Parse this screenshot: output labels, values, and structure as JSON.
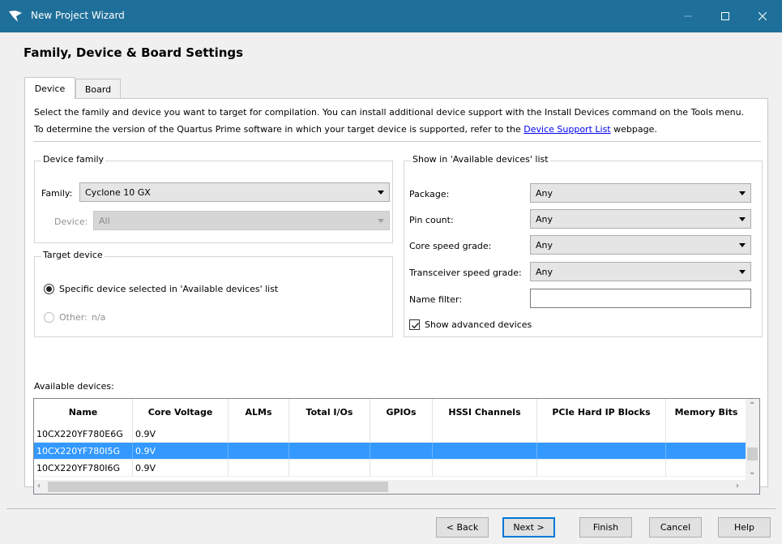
{
  "window": {
    "title": "New Project Wizard"
  },
  "page": {
    "title": "Family, Device & Board Settings"
  },
  "tabs": [
    {
      "label": "Device"
    },
    {
      "label": "Board"
    }
  ],
  "description": {
    "line1": "Select the family and device you want to target for compilation. You can install additional device support with the Install Devices command on the Tools menu.",
    "line2_prefix": "To determine the version of the Quartus Prime software in which your target device is supported, refer to the ",
    "link": "Device Support List",
    "line2_suffix": " webpage."
  },
  "device_family": {
    "legend": "Device family",
    "family_label": "Family:",
    "family_value": "Cyclone 10 GX",
    "device_label": "Device:",
    "device_value": "All"
  },
  "target_device": {
    "legend": "Target device",
    "specific_label": "Specific device selected in 'Available devices' list",
    "other_label": "Other:",
    "other_value": "n/a"
  },
  "show_list": {
    "legend": "Show in 'Available devices' list",
    "package_label": "Package:",
    "package_value": "Any",
    "pin_label": "Pin count:",
    "pin_value": "Any",
    "speed_label": "Core speed grade:",
    "speed_value": "Any",
    "xcvr_label": "Transceiver speed grade:",
    "xcvr_value": "Any",
    "name_filter_label": "Name filter:",
    "name_filter_value": "",
    "advanced_label": "Show advanced devices"
  },
  "available": {
    "label": "Available devices:",
    "columns": [
      "Name",
      "Core Voltage",
      "ALMs",
      "Total I/Os",
      "GPIOs",
      "HSSI Channels",
      "PCIe Hard IP Blocks",
      "Memory Bits"
    ],
    "rows": [
      [
        "10CX220YF780E6G",
        "0.9V",
        "",
        "",
        "",
        "",
        "",
        ""
      ],
      [
        "10CX220YF780I5G",
        "0.9V",
        "",
        "",
        "",
        "",
        "",
        ""
      ],
      [
        "10CX220YF780I6G",
        "0.9V",
        "",
        "",
        "",
        "",
        "",
        ""
      ]
    ]
  },
  "buttons": {
    "back": "< Back",
    "next": "Next >",
    "finish": "Finish",
    "cancel": "Cancel",
    "help": "Help"
  },
  "icons": {
    "app": "quartus-logo-icon",
    "minimize": "minimize-icon",
    "maximize": "maximize-icon",
    "close": "close-icon"
  },
  "colors": {
    "titlebar": "#1e6f99",
    "selection": "#3399ff",
    "link": "#0000ee"
  }
}
